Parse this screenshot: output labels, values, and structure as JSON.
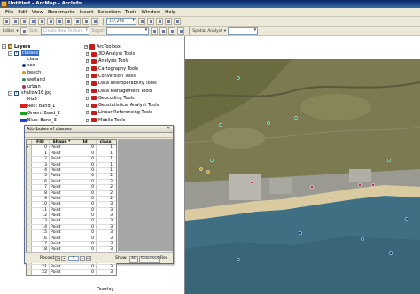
{
  "window": {
    "title": "Untitled - ArcMap - ArcInfo"
  },
  "menu": [
    "File",
    "Edit",
    "View",
    "Bookmarks",
    "Insert",
    "Selection",
    "Tools",
    "Window",
    "Help"
  ],
  "toolbar": {
    "scale": "1:7,266",
    "task_label": "Task:",
    "task_value": "Create New Feature",
    "target_label": "Target:",
    "editor_label": "Editor",
    "spatial_analyst": "Spatial Analyst",
    "tool_icons": [
      "new-icon",
      "open-icon",
      "save-icon",
      "print-icon",
      "cut-icon",
      "copy-icon",
      "paste-icon",
      "delete-icon",
      "undo-icon",
      "redo-icon",
      "add-data-icon"
    ]
  },
  "toc": {
    "root": "Layers",
    "layers": [
      {
        "name": "classes",
        "legend_title": "class",
        "symbols": [
          {
            "label": "sea",
            "color": "#1f3f8f"
          },
          {
            "label": "beach",
            "color": "#c8a018"
          },
          {
            "label": "wetland",
            "color": "#2e8b57"
          },
          {
            "label": "urban",
            "color": "#b03060"
          }
        ]
      },
      {
        "name": "shallow16.jpg",
        "legend_title": "RGB",
        "bands": [
          {
            "label": "Red:",
            "band": "Band_1",
            "color": "#e02020"
          },
          {
            "label": "Green:",
            "band": "Band_2",
            "color": "#20a020"
          },
          {
            "label": "Blue:",
            "band": "Band_3",
            "color": "#2040e0"
          }
        ]
      }
    ]
  },
  "arctoolbox": {
    "root": "ArcToolbox",
    "items": [
      "3D Analyst Tools",
      "Analysis Tools",
      "Cartography Tools",
      "Conversion Tools",
      "Data Interoperability Tools",
      "Data Management Tools",
      "Geocoding Tools",
      "Geostatistical Analyst Tools",
      "Linear Referencing Tools",
      "Mobile Tools",
      "Multidimension Tools"
    ],
    "partial_bottom": "Overlay"
  },
  "attributes": {
    "title": "Attributes of classes",
    "columns": [
      "FID",
      "Shape *",
      "Id",
      "class"
    ],
    "rows": [
      [
        "0",
        "Point",
        "0",
        "1"
      ],
      [
        "1",
        "Point",
        "0",
        "1"
      ],
      [
        "2",
        "Point",
        "0",
        "1"
      ],
      [
        "3",
        "Point",
        "0",
        "1"
      ],
      [
        "4",
        "Point",
        "0",
        "1"
      ],
      [
        "5",
        "Point",
        "0",
        "2"
      ],
      [
        "6",
        "Point",
        "0",
        "2"
      ],
      [
        "7",
        "Point",
        "0",
        "2"
      ],
      [
        "8",
        "Point",
        "0",
        "2"
      ],
      [
        "9",
        "Point",
        "0",
        "2"
      ],
      [
        "10",
        "Point",
        "0",
        "3"
      ],
      [
        "11",
        "Point",
        "0",
        "3"
      ],
      [
        "12",
        "Point",
        "0",
        "3"
      ],
      [
        "13",
        "Point",
        "0",
        "3"
      ],
      [
        "14",
        "Point",
        "0",
        "3"
      ],
      [
        "15",
        "Point",
        "0",
        "3"
      ],
      [
        "16",
        "Point",
        "0",
        "3"
      ],
      [
        "17",
        "Point",
        "0",
        "3"
      ],
      [
        "18",
        "Point",
        "0",
        "3"
      ],
      [
        "19",
        "Point",
        "0",
        "3"
      ],
      [
        "20",
        "Point",
        "0",
        "3"
      ],
      [
        "21",
        "Point",
        "0",
        "3"
      ],
      [
        "22",
        "Point",
        "0",
        "3"
      ]
    ],
    "record_label": "Record:",
    "record_value": "1",
    "show_label": "Show:",
    "all_label": "All",
    "selected_label": "Selected",
    "records_label": "Rec"
  },
  "map": {
    "colors": {
      "sea": "#3e6f82",
      "land": "#7a7a4e",
      "beach": "#d8c8a0",
      "urban": "#9a9a92"
    }
  }
}
